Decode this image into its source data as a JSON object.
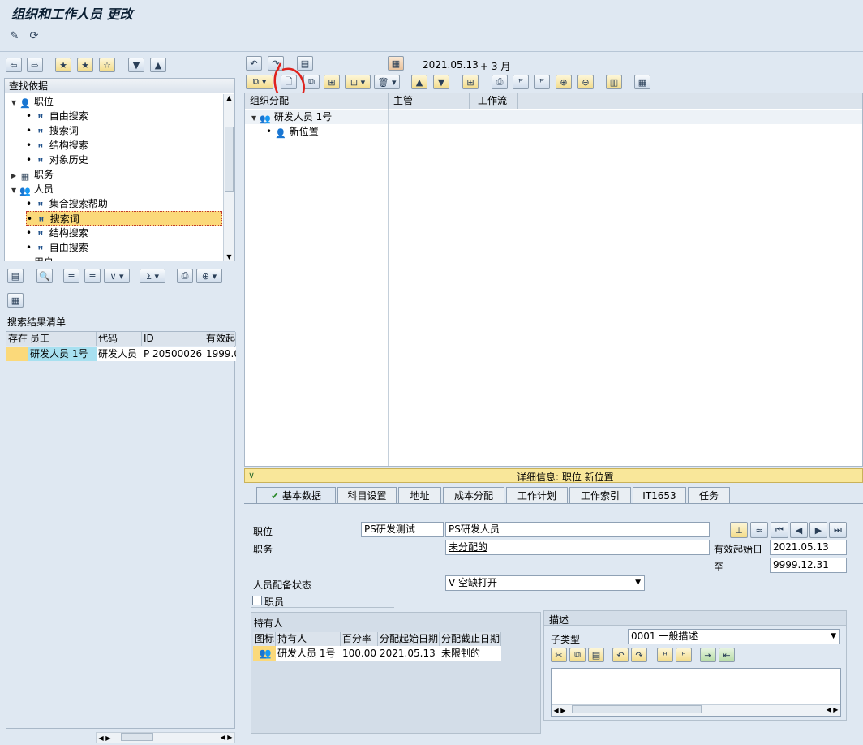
{
  "window": {
    "title": "组织和工作人员 更改"
  },
  "left_tree": {
    "header": "查找依据",
    "items": [
      {
        "label": "职位"
      },
      {
        "label": "自由搜索"
      },
      {
        "label": "搜索词"
      },
      {
        "label": "结构搜索"
      },
      {
        "label": "对象历史"
      },
      {
        "label": "职务"
      },
      {
        "label": "人员"
      },
      {
        "label": "集合搜索帮助"
      },
      {
        "label": "搜索词"
      },
      {
        "label": "结构搜索"
      },
      {
        "label": "自由搜索"
      },
      {
        "label": "用户"
      }
    ]
  },
  "results": {
    "title": "搜索结果清单",
    "columns": [
      "存在",
      "员工",
      "代码",
      "ID",
      "有效起"
    ],
    "rows": [
      [
        "",
        "研发人员 1号",
        "研发人员",
        "P  20500026",
        "1999.0"
      ]
    ]
  },
  "structure": {
    "date": "2021.05.13",
    "range": "+ 3 月",
    "columns": [
      "组织分配",
      "主管",
      "工作流"
    ],
    "nodes": [
      {
        "label": "研发人员 1号"
      },
      {
        "label": "新位置"
      }
    ]
  },
  "detail": {
    "header": "详细信息:  职位 新位置",
    "tabs": [
      "基本数据",
      "科目设置",
      "地址",
      "成本分配",
      "工作计划",
      "工作索引",
      "IT1653",
      "任务"
    ],
    "position_label": "职位",
    "position_short": "PS研发测试",
    "position_long": "PS研发人员",
    "job_label": "职务",
    "job_value": "未分配的",
    "valid_from_label": "有效起始日",
    "valid_from": "2021.05.13",
    "to_label": "至",
    "valid_to": "9999.12.31",
    "staffing_label": "人员配备状态",
    "staffing_value": "V 空缺打开",
    "staff_checkbox_label": "职员",
    "holders_title": "持有人",
    "holders_columns": [
      "图标",
      "持有人",
      "百分率",
      "分配起始日期",
      "分配截止日期"
    ],
    "holders_rows": [
      [
        "",
        "研发人员 1号",
        "100.00",
        "2021.05.13",
        "未限制的"
      ]
    ],
    "desc_title": "描述",
    "subtype_label": "子类型",
    "subtype_value": "0001 一般描述"
  },
  "colors": {
    "accent_yellow": "#f7d97c",
    "selected_bg": "#fbd97a",
    "panel_bg": "#dfe8f2",
    "annotation_red": "#e0221c"
  }
}
